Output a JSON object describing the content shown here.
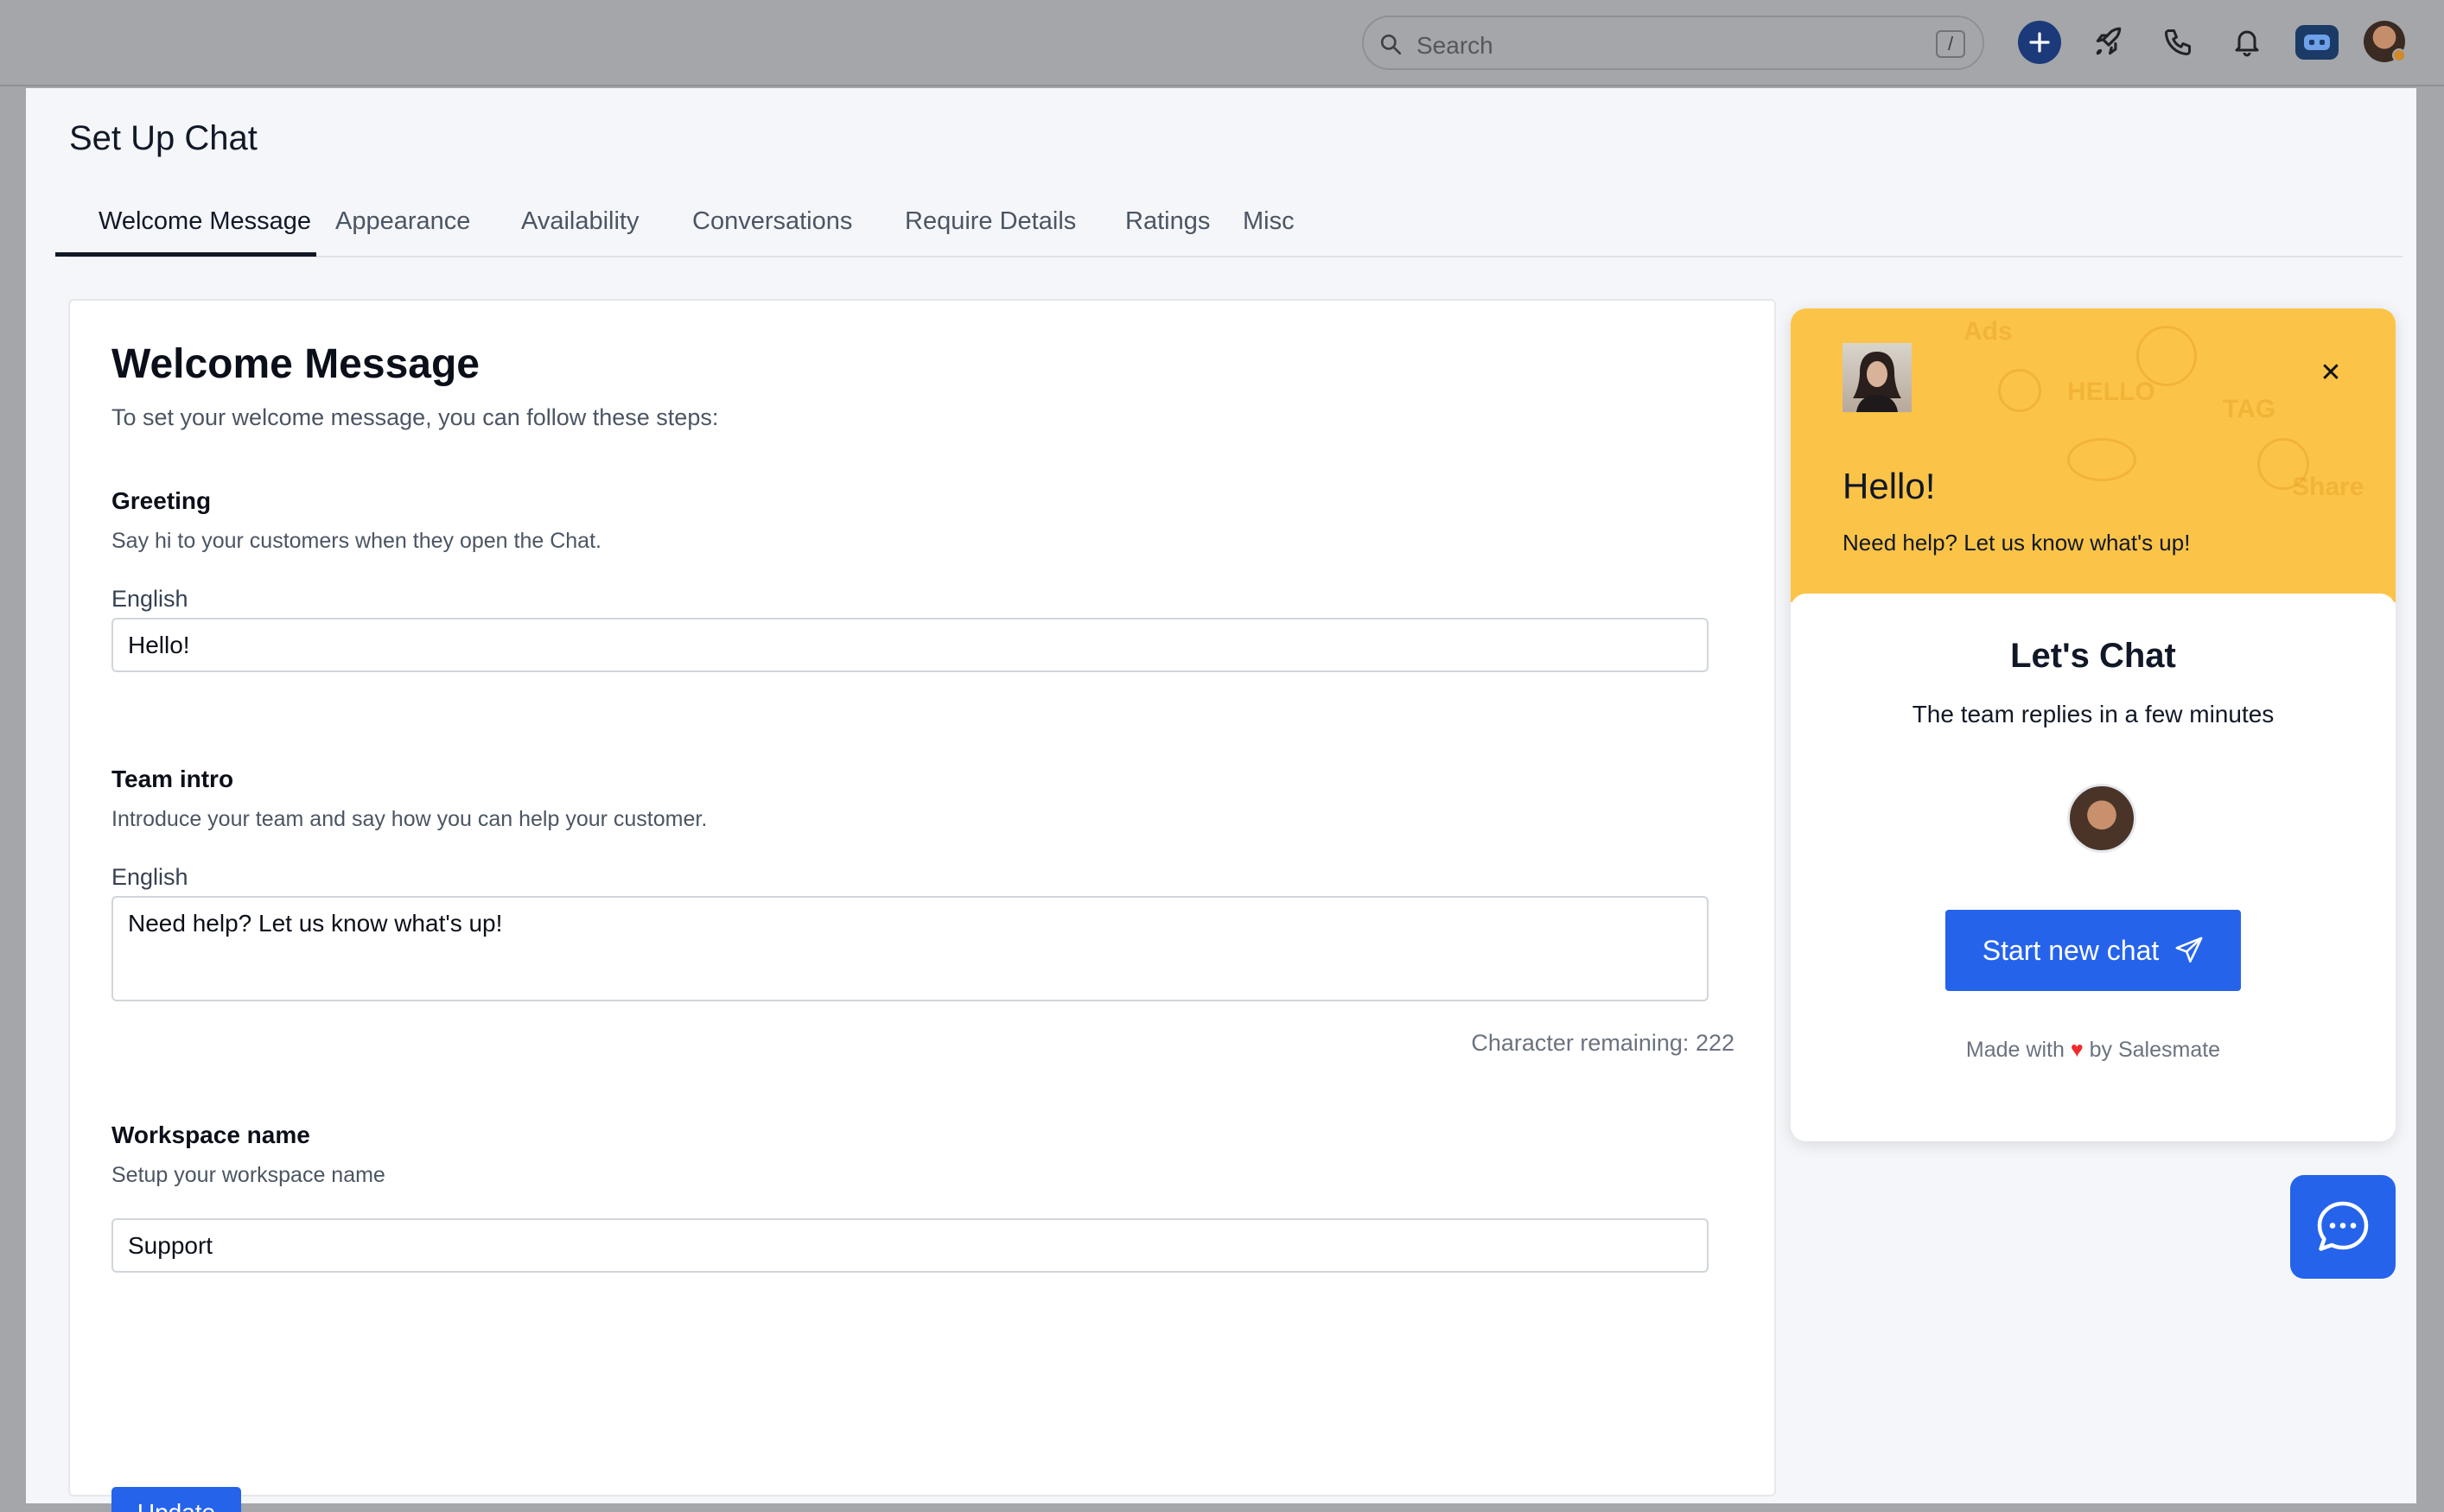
{
  "topbar": {
    "search": {
      "placeholder": "Search",
      "shortcut": "/"
    },
    "icons": [
      "search-icon",
      "plus-icon",
      "rocket-icon",
      "phone-icon",
      "bell-icon",
      "bot-icon",
      "avatar"
    ],
    "accent": "#1c3a7a"
  },
  "page": {
    "title": "Set Up Chat",
    "tabs": [
      {
        "label": "Welcome Message",
        "active": true
      },
      {
        "label": "Appearance",
        "active": false
      },
      {
        "label": "Availability",
        "active": false
      },
      {
        "label": "Conversations",
        "active": false
      },
      {
        "label": "Require Details",
        "active": false
      },
      {
        "label": "Ratings",
        "active": false
      },
      {
        "label": "Misc",
        "active": false
      }
    ]
  },
  "form": {
    "title": "Welcome Message",
    "subtitle": "To set your welcome message, you can follow these steps:",
    "greeting": {
      "title": "Greeting",
      "desc": "Say hi to your customers when they open the Chat.",
      "lang": "English",
      "value": "Hello!"
    },
    "team_intro": {
      "title": "Team intro",
      "desc": "Introduce your team and say how you can help your customer.",
      "lang": "English",
      "value": "Need help? Let us know what's up!",
      "char_remaining": "Character remaining: 222"
    },
    "workspace": {
      "title": "Workspace name",
      "desc": "Setup your workspace name",
      "value": "Support"
    },
    "update_label": "Update",
    "primary_color": "#2563eb"
  },
  "preview": {
    "header_color": "#fbc448",
    "greeting": "Hello!",
    "intro": "Need help? Let us know what's up!",
    "chat_title": "Let's Chat",
    "replies": "The team replies in a few minutes",
    "start_button": "Start new chat",
    "footer_prefix": "Made with",
    "footer_heart": "♥",
    "footer_suffix": "by Salesmate",
    "doodle_words": [
      "HELLO",
      "TAG",
      "Share",
      "Ads"
    ]
  }
}
